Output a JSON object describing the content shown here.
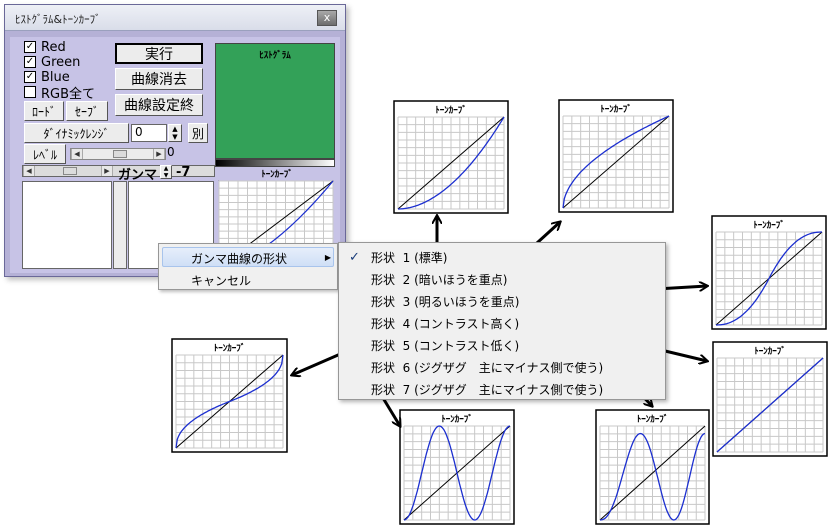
{
  "window": {
    "title": "ﾋｽﾄｸﾞﾗﾑ&ﾄｰﾝｶｰﾌﾞ",
    "close_label": "x",
    "channels": [
      {
        "label": "Red",
        "checked": true
      },
      {
        "label": "Green",
        "checked": true
      },
      {
        "label": "Blue",
        "checked": true
      },
      {
        "label": "RGB全て",
        "checked": false
      }
    ],
    "check_mark": "✓",
    "buttons": {
      "run": "実行",
      "clear_curve": "曲線消去",
      "curve_setting": "曲線設定終",
      "load": "ﾛｰﾄﾞ",
      "save": "ｾｰﾌﾞ",
      "dynamic_range": "ﾀﾞｲﾅﾐｯｸﾚﾝｼﾞ",
      "separate": "別",
      "level": "ﾚﾍﾞﾙ"
    },
    "dynamic_range_value": "0",
    "level_value": "0",
    "gamma_label": "ガンマ",
    "gamma_value": "-7",
    "histogram_title": "ﾋｽﾄｸﾞﾗﾑ",
    "histogram_color": "#33a158",
    "curve_title": "ﾄｰﾝｶｰﾌﾞ"
  },
  "context_menu": {
    "items": [
      {
        "label": "ガンマ曲線の形状",
        "has_submenu": true,
        "highlighted": true
      },
      {
        "label": "キャンセル",
        "has_submenu": false,
        "highlighted": false
      }
    ],
    "submenu_arrow": "▶"
  },
  "submenu": {
    "check_mark": "✓",
    "items": [
      {
        "prefix": "形状",
        "text": "1 (標準)",
        "checked": true
      },
      {
        "prefix": "形状",
        "text": "2 (暗いほうを重点)",
        "checked": false
      },
      {
        "prefix": "形状",
        "text": "3 (明るいほうを重点)",
        "checked": false
      },
      {
        "prefix": "形状",
        "text": "4 (コントラスト高く)",
        "checked": false
      },
      {
        "prefix": "形状",
        "text": "5 (コントラスト低く)",
        "checked": false
      },
      {
        "prefix": "形状",
        "text": "6 (ジグザグ　主にマイナス側で使う)",
        "checked": false
      },
      {
        "prefix": "形状",
        "text": "7 (ジグザグ　主にマイナス側で使う)",
        "checked": false
      }
    ]
  },
  "tone_curve_panels": [
    {
      "shape": "2",
      "title": "ﾄｰﾝｶｰﾌﾞ"
    },
    {
      "shape": "3",
      "title": "ﾄｰﾝｶｰﾌﾞ"
    },
    {
      "shape": "4",
      "title": "ﾄｰﾝｶｰﾌﾞ"
    },
    {
      "shape": "5",
      "title": "ﾄｰﾝｶｰﾌﾞ"
    },
    {
      "shape": "6",
      "title": "ﾄｰﾝｶｰﾌﾞ"
    },
    {
      "shape": "7",
      "title": "ﾄｰﾝｶｰﾌﾞ"
    },
    {
      "shape": "1",
      "title": "ﾄｰﾝｶｰﾌﾞ"
    }
  ],
  "colors": {
    "curve_line": "#1c2fd0",
    "grid_line": "#c8c8c8",
    "arrow": "#000000",
    "menu_highlight": "#cfdff6"
  }
}
